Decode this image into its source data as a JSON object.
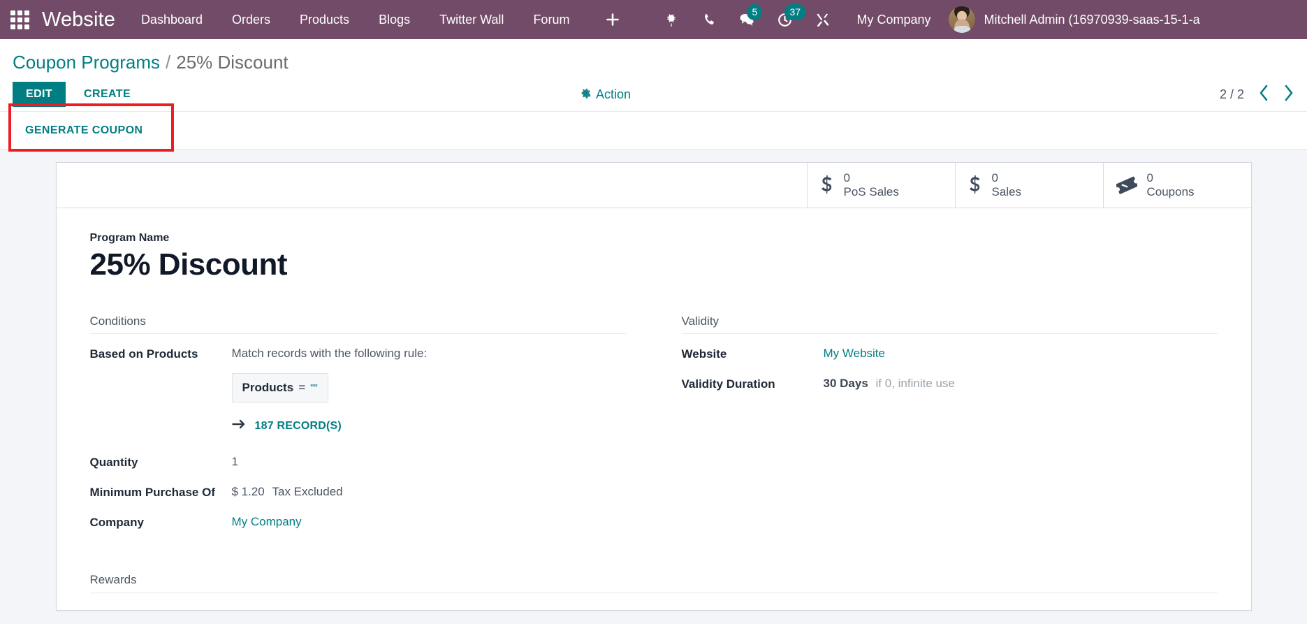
{
  "navbar": {
    "apps_icon": "apps-grid-icon",
    "brand": "Website",
    "menus": [
      {
        "label": "Dashboard"
      },
      {
        "label": "Orders"
      },
      {
        "label": "Products"
      },
      {
        "label": "Blogs"
      },
      {
        "label": "Twitter Wall"
      },
      {
        "label": "Forum"
      }
    ],
    "plus_icon": "plus-icon",
    "sys_icons": [
      {
        "name": "bug-icon",
        "badge": ""
      },
      {
        "name": "phone-icon",
        "badge": ""
      },
      {
        "name": "messages-icon",
        "badge": "5"
      },
      {
        "name": "activities-clock-icon",
        "badge": "37"
      },
      {
        "name": "tools-icon",
        "badge": ""
      }
    ],
    "company": "My Company",
    "user": "Mitchell Admin (16970939-saas-15-1-a",
    "bg_color": "#714B67",
    "badge_color": "#017e84"
  },
  "control_panel": {
    "breadcrumb_root": "Coupon Programs",
    "breadcrumb_sep": "/",
    "breadcrumb_current": "25% Discount",
    "edit_label": "EDIT",
    "create_label": "CREATE",
    "action_label": "Action",
    "action_icon": "gear-icon",
    "pager_count": "2 / 2",
    "pager_prev_icon": "chevron-left-icon",
    "pager_next_icon": "chevron-right-icon"
  },
  "button_strip": {
    "generate_coupon_label": "GENERATE COUPON",
    "highlight_color": "#ee1c23"
  },
  "stat_buttons": [
    {
      "icon": "dollar-icon",
      "value": "0",
      "label": "PoS Sales"
    },
    {
      "icon": "dollar-icon",
      "value": "0",
      "label": "Sales"
    },
    {
      "icon": "ticket-icon",
      "value": "0",
      "label": "Coupons"
    }
  ],
  "record": {
    "program_name_label": "Program Name",
    "program_name_value": "25% Discount",
    "conditions": {
      "title": "Conditions",
      "based_on_products_label": "Based on Products",
      "domain_intro": "Match records with the following rule:",
      "domain_field": "Products",
      "domain_operator": "=",
      "domain_value": "\"\"",
      "records_link": "187 RECORD(S)",
      "records_arrow_icon": "arrow-right-icon",
      "quantity_label": "Quantity",
      "quantity_value": "1",
      "minimum_purchase_label": "Minimum Purchase Of",
      "minimum_purchase_value": "$ 1.20",
      "minimum_purchase_suffix": "Tax Excluded",
      "company_label": "Company",
      "company_value": "My Company"
    },
    "validity": {
      "title": "Validity",
      "website_label": "Website",
      "website_value": "My Website",
      "duration_label": "Validity Duration",
      "duration_value": "30 Days",
      "duration_hint": "if 0, infinite use"
    },
    "rewards_title": "Rewards"
  },
  "colors": {
    "primary": "#017e84",
    "navbar": "#714B67",
    "page_bg": "#f4f5f8"
  }
}
